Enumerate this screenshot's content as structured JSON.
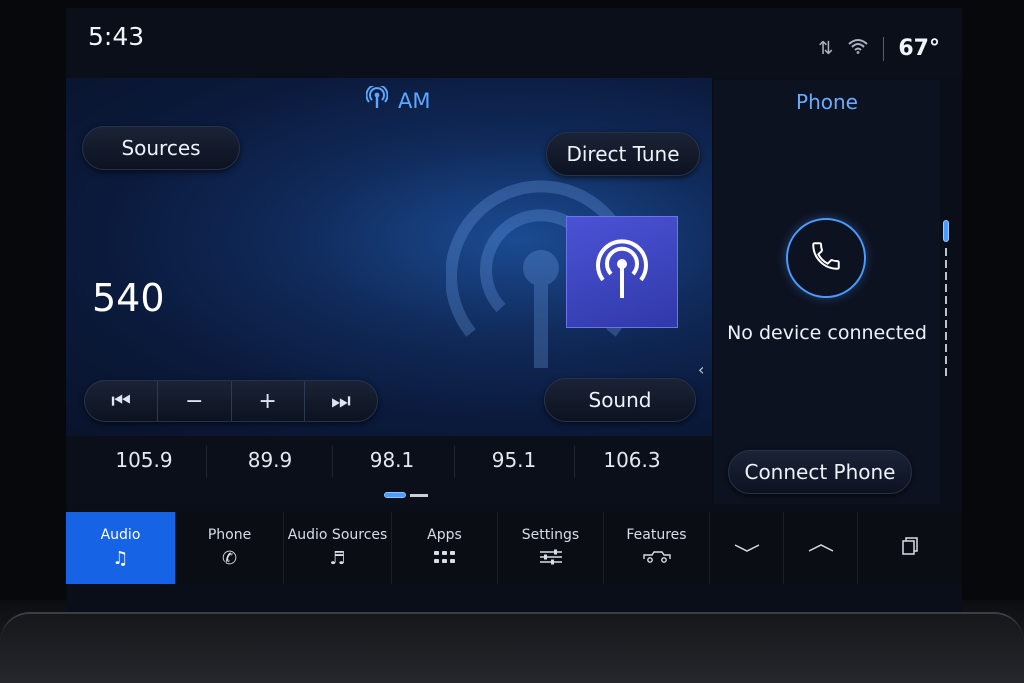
{
  "status": {
    "time": "5:43",
    "temperature": "67°",
    "icons": [
      "signal-arrows-icon",
      "wifi-icon"
    ]
  },
  "audio": {
    "source": "AM",
    "sources_label": "Sources",
    "direct_tune_label": "Direct Tune",
    "sound_label": "Sound",
    "frequency": "540",
    "transport": {
      "prev_icon": "⏮",
      "minus_icon": "−",
      "plus_icon": "+",
      "next_icon": "⏭"
    }
  },
  "presets": [
    "105.9",
    "89.9",
    "98.1",
    "95.1",
    "106.3"
  ],
  "phone": {
    "title": "Phone",
    "status": "No device connected",
    "connect_label": "Connect Phone"
  },
  "nav": {
    "items": [
      {
        "label": "Audio",
        "icon": "music-note-icon"
      },
      {
        "label": "Phone",
        "icon": "phone-icon"
      },
      {
        "label": "Audio Sources",
        "icon": "audio-sources-icon"
      },
      {
        "label": "Apps",
        "icon": "apps-grid-icon"
      },
      {
        "label": "Settings",
        "icon": "sliders-icon"
      },
      {
        "label": "Features",
        "icon": "truck-icon"
      }
    ],
    "active": "Audio"
  },
  "colors": {
    "accent": "#1663e6",
    "highlight_text": "#5da7ff",
    "art_tile": "#3b44c0"
  }
}
